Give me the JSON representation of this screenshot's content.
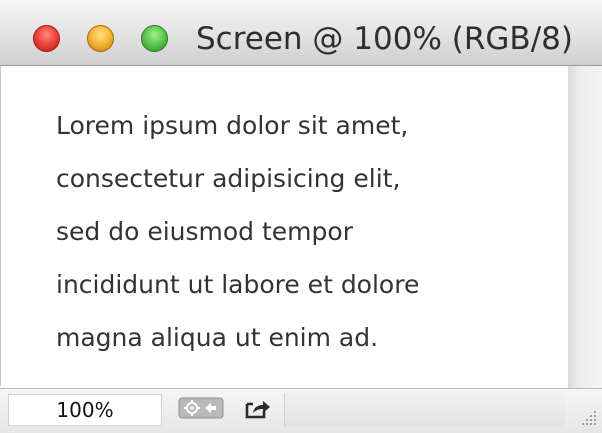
{
  "window": {
    "title": "Screen @ 100% (RGB/8)",
    "controls": {
      "close": "close-button",
      "minimize": "minimize-button",
      "zoom": "zoom-button"
    }
  },
  "document": {
    "lines": [
      "Lorem ipsum dolor sit amet,",
      "consectetur adipisicing elit,",
      "sed do eiusmod tempor",
      "incididunt ut labore et dolore",
      "magna aliqua ut enim ad."
    ]
  },
  "statusbar": {
    "zoom_level": "100%",
    "icons": [
      "document-info-icon",
      "share-export-icon",
      "resize-grip-icon"
    ]
  },
  "colors": {
    "close": "#f0463c",
    "minimize": "#f6b93a",
    "zoom": "#5ec852",
    "text": "#333333"
  }
}
